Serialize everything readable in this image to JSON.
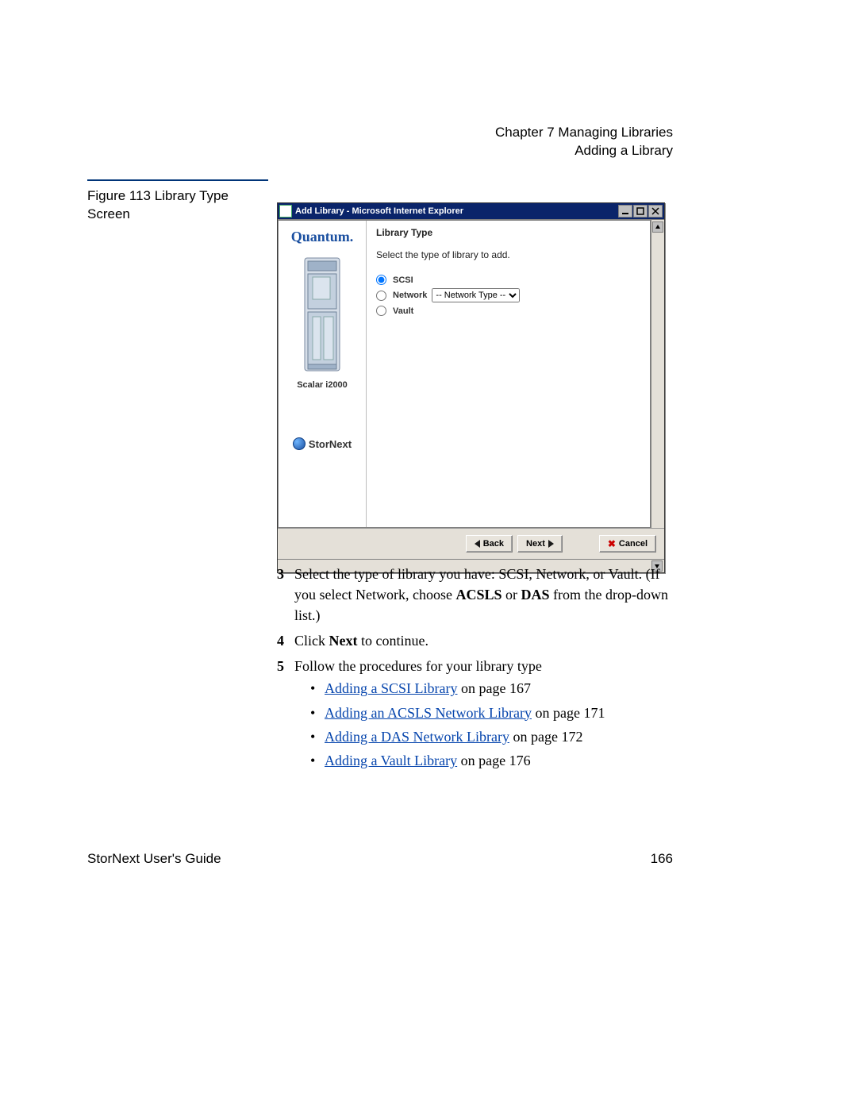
{
  "header": {
    "chapter": "Chapter 7  Managing Libraries",
    "section": "Adding a Library"
  },
  "caption": "Figure 113  Library Type Screen",
  "window": {
    "title": "Add Library - Microsoft Internet Explorer",
    "sidebar": {
      "brand": "Quantum.",
      "model": "Scalar i2000",
      "product": "StorNext"
    },
    "content": {
      "heading": "Library Type",
      "subtext": "Select the type of library to add.",
      "options": {
        "scsi": "SCSI",
        "network": "Network",
        "vault": "Vault"
      },
      "network_select": "-- Network Type --"
    },
    "buttons": {
      "back": "Back",
      "next": "Next",
      "cancel": "Cancel"
    }
  },
  "steps": {
    "s3": {
      "pre": "Select the type of library you have: SCSI, Network, or Vault. (If you select Network, choose ",
      "b1": "ACSLS",
      "mid": " or ",
      "b2": "DAS",
      "post": " from the drop-down list.)"
    },
    "s4": {
      "pre": "Click ",
      "b": "Next",
      "post": " to continue."
    },
    "s5": "Follow the procedures for your library type",
    "bullets": {
      "b1": {
        "link": "Adding a SCSI Library",
        "tail": " on page  167"
      },
      "b2": {
        "link": "Adding an ACSLS Network Library",
        "tail": " on page  171"
      },
      "b3": {
        "link": "Adding a DAS Network Library",
        "tail": " on page  172"
      },
      "b4": {
        "link": "Adding a Vault Library",
        "tail": " on page  176"
      }
    }
  },
  "footer": {
    "left": "StorNext User's Guide",
    "right": "166"
  }
}
